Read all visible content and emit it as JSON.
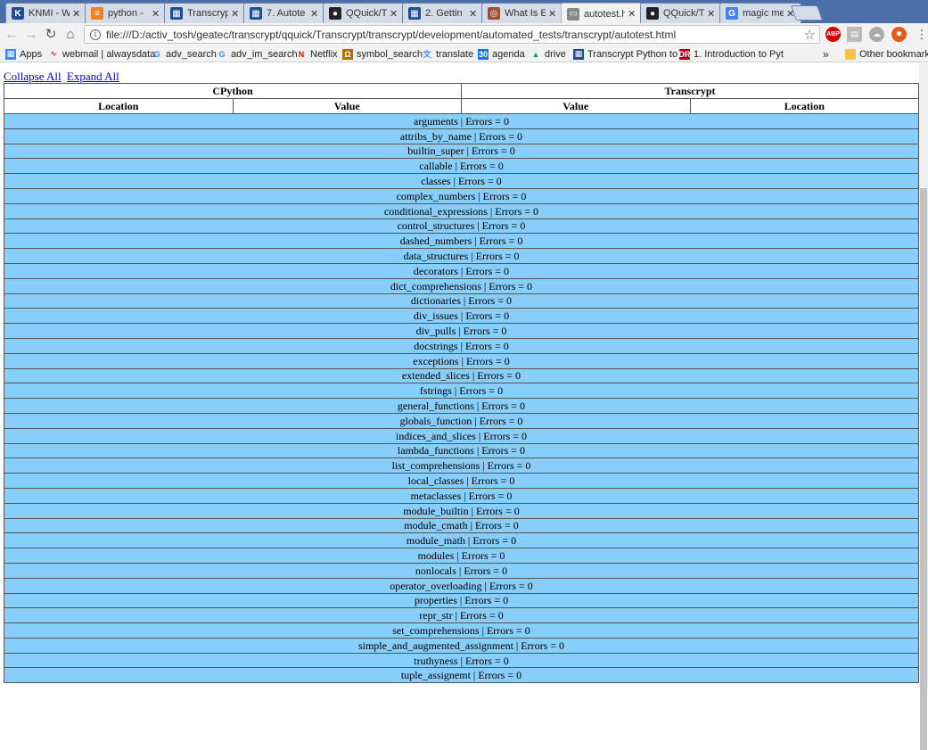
{
  "tabs": [
    {
      "title": "KNMI - W",
      "icon": "knmi-icon",
      "color": "#1f4e99",
      "glyph": "K"
    },
    {
      "title": "python -",
      "icon": "stackoverflow-icon",
      "color": "#f48024",
      "glyph": "≡"
    },
    {
      "title": "Transcryp",
      "icon": "transcrypt-icon",
      "color": "#1f4e99",
      "glyph": "▦"
    },
    {
      "title": "7. Autote",
      "icon": "transcrypt-icon",
      "color": "#1f4e99",
      "glyph": "▦"
    },
    {
      "title": "QQuick/T",
      "icon": "github-icon",
      "color": "#222222",
      "glyph": "●"
    },
    {
      "title": "2. Gettin",
      "icon": "transcrypt-icon",
      "color": "#1f4e99",
      "glyph": "▦"
    },
    {
      "title": "What Is E",
      "icon": "globe-icon",
      "color": "#a05030",
      "glyph": "◎"
    },
    {
      "title": "autotest.h",
      "icon": "document-icon",
      "color": "#888888",
      "glyph": "▭"
    },
    {
      "title": "QQuick/T",
      "icon": "github-icon",
      "color": "#222222",
      "glyph": "●"
    },
    {
      "title": "magic me",
      "icon": "google-icon",
      "color": "#4285f4",
      "glyph": "G"
    }
  ],
  "active_tab_index": 7,
  "toolbar": {
    "url": "file:///D:/activ_tosh/geatec/transcrypt/qquick/Transcrypt/transcrypt/development/automated_tests/transcrypt/autotest.html"
  },
  "bookmarks": [
    {
      "label": "Apps",
      "icon": "apps-grid-icon"
    },
    {
      "label": "webmail | alwaysdata",
      "icon": "alwaysdata-icon"
    },
    {
      "label": "adv_search",
      "icon": "google-icon"
    },
    {
      "label": "adv_im_search",
      "icon": "google-icon"
    },
    {
      "label": "Netflix",
      "icon": "netflix-icon"
    },
    {
      "label": "symbol_search",
      "icon": "symbol-icon"
    },
    {
      "label": "translate",
      "icon": "translate-icon"
    },
    {
      "label": "agenda",
      "icon": "calendar-icon"
    },
    {
      "label": "drive",
      "icon": "drive-icon"
    },
    {
      "label": "Transcrypt Python to",
      "icon": "transcrypt-icon"
    },
    {
      "label": "1. Introduction to Pyt",
      "icon": "dr-icon"
    }
  ],
  "bookmarks_overflow": "»",
  "other_bookmarks": "Other bookmarks",
  "page": {
    "collapse_all": "Collapse All",
    "expand_all": "Expand All",
    "header": {
      "cpython": "CPython",
      "transcrypt": "Transcrypt",
      "col_location_left": "Location",
      "col_value_left": "Value",
      "col_value_right": "Value",
      "col_location_right": "Location"
    },
    "rows": [
      "arguments | Errors = 0",
      "attribs_by_name | Errors = 0",
      "builtin_super | Errors = 0",
      "callable | Errors = 0",
      "classes | Errors = 0",
      "complex_numbers | Errors = 0",
      "conditional_expressions | Errors = 0",
      "control_structures | Errors = 0",
      "dashed_numbers | Errors = 0",
      "data_structures | Errors = 0",
      "decorators | Errors = 0",
      "dict_comprehensions | Errors = 0",
      "dictionaries | Errors = 0",
      "div_issues | Errors = 0",
      "div_pulls | Errors = 0",
      "docstrings | Errors = 0",
      "exceptions | Errors = 0",
      "extended_slices | Errors = 0",
      "fstrings | Errors = 0",
      "general_functions | Errors = 0",
      "globals_function | Errors = 0",
      "indices_and_slices | Errors = 0",
      "lambda_functions | Errors = 0",
      "list_comprehensions | Errors = 0",
      "local_classes | Errors = 0",
      "metaclasses | Errors = 0",
      "module_builtin | Errors = 0",
      "module_cmath | Errors = 0",
      "module_math | Errors = 0",
      "modules | Errors = 0",
      "nonlocals | Errors = 0",
      "operator_overloading | Errors = 0",
      "properties | Errors = 0",
      "repr_str | Errors = 0",
      "set_comprehensions | Errors = 0",
      "simple_and_augmented_assignment | Errors = 0",
      "truthyness | Errors = 0",
      "tuple_assignemt | Errors = 0"
    ]
  },
  "colors": {
    "row_bg": "#87cefa",
    "link": "#0000ee",
    "tabstrip": "#4a6ea9"
  }
}
